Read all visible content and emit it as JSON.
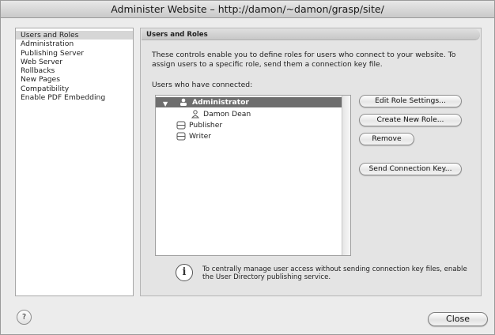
{
  "window": {
    "title": "Administer Website – http://damon/~damon/grasp/site/"
  },
  "sidebar": {
    "items": [
      {
        "label": "Users and Roles",
        "selected": true
      },
      {
        "label": "Administration"
      },
      {
        "label": "Publishing Server"
      },
      {
        "label": "Web Server"
      },
      {
        "label": "Rollbacks"
      },
      {
        "label": "New Pages"
      },
      {
        "label": "Compatibility"
      },
      {
        "label": "Enable PDF Embedding"
      }
    ]
  },
  "panel": {
    "header": "Users and Roles",
    "description": "These controls enable you to define roles for users who connect to your website. To assign users to a specific role, send them a connection key file.",
    "users_label": "Users who have connected:"
  },
  "tree": {
    "rows": [
      {
        "label": "Administrator",
        "icon": "role-group-icon",
        "expanded": true,
        "selected": true
      },
      {
        "label": "Damon Dean",
        "icon": "person-icon"
      },
      {
        "label": "Publisher",
        "icon": "role-group-icon"
      },
      {
        "label": "Writer",
        "icon": "role-group-icon"
      }
    ]
  },
  "buttons": {
    "edit_role": "Edit Role Settings...",
    "create_role": "Create New Role...",
    "remove": "Remove",
    "send_key": "Send Connection Key...",
    "help": "?",
    "close": "Close"
  },
  "info": {
    "icon": "i",
    "text": "To centrally manage user access without sending connection key files, enable the User Directory publishing service."
  }
}
